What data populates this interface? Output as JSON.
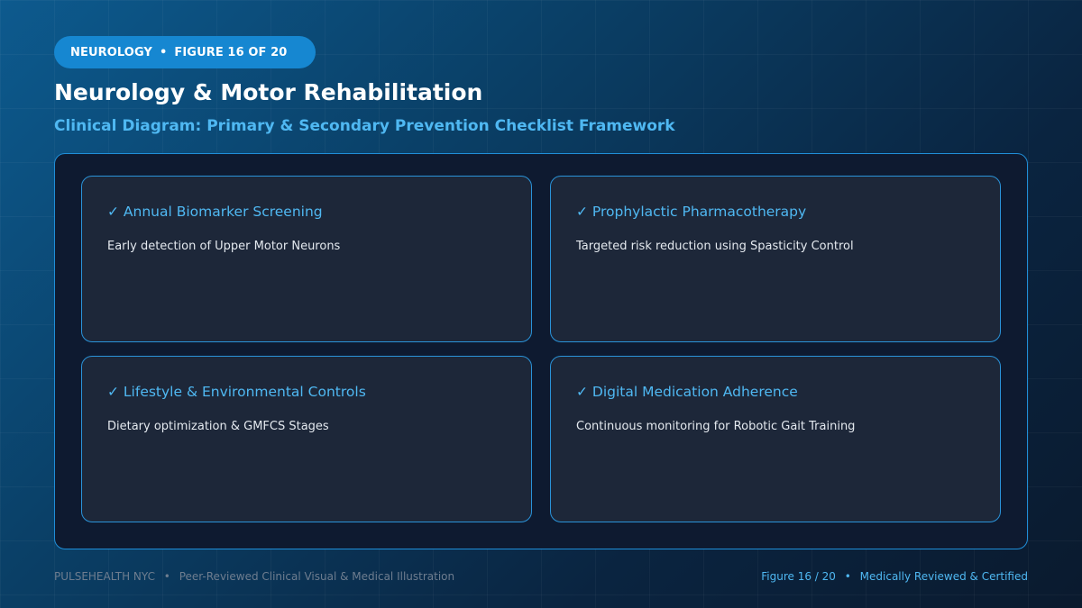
{
  "badge": {
    "section": "NEUROLOGY",
    "separator": "•",
    "figure": "FIGURE 16 OF 20"
  },
  "header": {
    "title": "Neurology & Motor Rehabilitation",
    "subtitle": "Clinical Diagram: Primary & Secondary Prevention Checklist Framework"
  },
  "checklist": {
    "items": [
      {
        "title": "✓ Annual Biomarker Screening",
        "description": "Early detection of Upper Motor Neurons"
      },
      {
        "title": "✓ Prophylactic Pharmacotherapy",
        "description": "Targeted risk reduction using Spasticity Control"
      },
      {
        "title": "✓ Lifestyle & Environmental Controls",
        "description": "Dietary optimization & GMFCS Stages"
      },
      {
        "title": "✓ Digital Medication Adherence",
        "description": "Continuous monitoring for Robotic Gait Training"
      }
    ]
  },
  "footer": {
    "brand": "PULSEHEALTH NYC",
    "separator": "•",
    "tagline": "Peer-Reviewed Clinical Visual & Medical Illustration",
    "figure_label": "Figure 16 / 20",
    "certification": "Medically Reviewed & Certified"
  },
  "colors": {
    "accent": "#4fb8f2",
    "badge": "#1687d1",
    "card_border": "#2a93d9",
    "card_bg": "#1d2739"
  }
}
